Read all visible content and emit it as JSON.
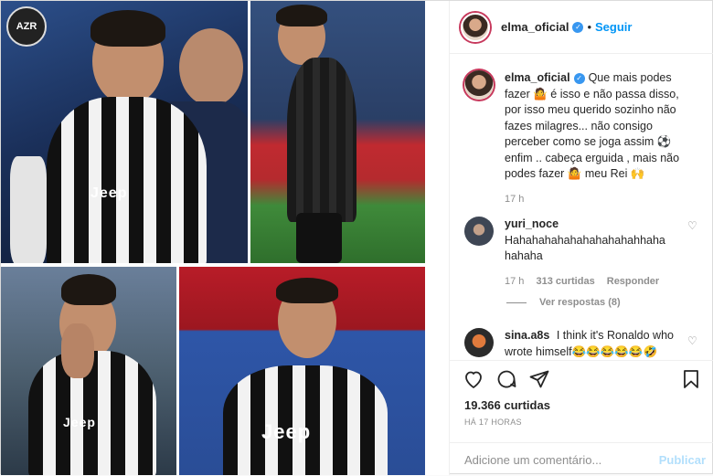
{
  "collage": {
    "logo_text": "AZR",
    "shirt_texts": [
      "Jeep",
      "Jeep",
      "Jeep"
    ]
  },
  "header": {
    "username": "elma_oficial",
    "follow_label": "Seguir"
  },
  "caption": {
    "username": "elma_oficial",
    "text": "Que mais podes fazer 🤷 é isso e não passa disso, por isso meu querido sozinho não fazes milagres... não consigo perceber como se joga assim ⚽ enfim .. cabeça erguida , mais não podes fazer 🤷 meu Rei 🙌",
    "time": "17 h"
  },
  "comments": [
    {
      "username": "yuri_noce",
      "text": "Hahahahahahahahahahahhaha hahaha",
      "time": "17 h",
      "likes": "313 curtidas",
      "reply_label": "Responder"
    },
    {
      "username": "sina.a8s",
      "text": "I think it's Ronaldo who wrote himself😂😂😂😂😂🤣"
    }
  ],
  "view_replies": "Ver respostas (8)",
  "likes_count": "19.366 curtidas",
  "posted_time": "HÁ 17 HORAS",
  "comment_placeholder": "Adicione um comentário...",
  "publish_label": "Publicar"
}
